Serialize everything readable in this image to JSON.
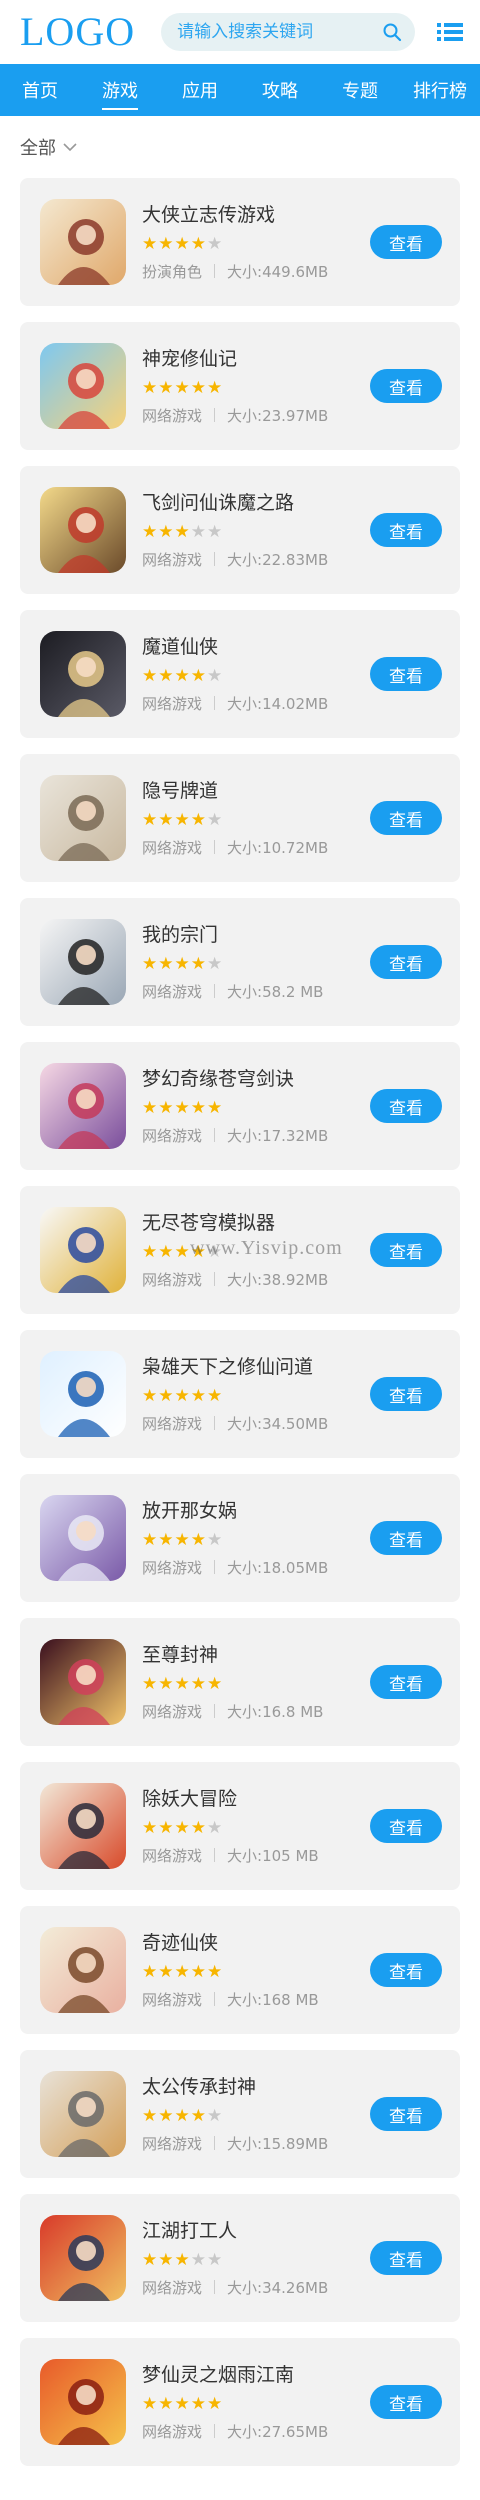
{
  "header": {
    "logo": "LOGO",
    "search_placeholder": "请输入搜索关键词",
    "search_icon": "search-icon",
    "menu_icon": "list-menu-icon"
  },
  "nav": {
    "active_index": 1,
    "items": [
      "首页",
      "游戏",
      "应用",
      "攻略",
      "专题",
      "排行榜"
    ]
  },
  "filter": {
    "label": "全部"
  },
  "button_label": "查看",
  "watermark": "www.Yisvip.com",
  "colors": {
    "accent": "#1a9ef0",
    "star": "#f7b500",
    "star_off": "#c8c8c8",
    "card_bg": "#f2f2f2"
  },
  "apps": [
    {
      "name": "大侠立志传游戏",
      "rating": 4,
      "category": "扮演角色",
      "size": "大小:449.6MB",
      "icon": "straw-hat-warrior-icon"
    },
    {
      "name": "神宠修仙记",
      "rating": 5,
      "category": "网络游戏",
      "size": "大小:23.97MB",
      "icon": "cute-pet-dragon-icon"
    },
    {
      "name": "飞剑问仙诛魔之路",
      "rating": 3,
      "category": "网络游戏",
      "size": "大小:22.83MB",
      "icon": "flying-sword-icon"
    },
    {
      "name": "魔道仙侠",
      "rating": 4,
      "category": "网络游戏",
      "size": "大小:14.02MB",
      "icon": "dark-warrior-icon"
    },
    {
      "name": "隐号牌道",
      "rating": 4,
      "category": "网络游戏",
      "size": "大小:10.72MB",
      "icon": "old-sage-icon"
    },
    {
      "name": "我的宗门",
      "rating": 4,
      "category": "网络游戏",
      "size": "大小:58.2 MB",
      "icon": "ink-swordsman-icon"
    },
    {
      "name": "梦幻奇缘苍穹剑诀",
      "rating": 5,
      "category": "网络游戏",
      "size": "大小:17.32MB",
      "icon": "fairy-girl-icon"
    },
    {
      "name": "无尽苍穹模拟器",
      "rating": 4,
      "category": "网络游戏",
      "size": "大小:38.92MB",
      "icon": "calligraphy-logo-icon"
    },
    {
      "name": "枭雄天下之修仙问道",
      "rating": 5,
      "category": "网络游戏",
      "size": "大小:34.50MB",
      "icon": "xian-character-icon"
    },
    {
      "name": "放开那女娲",
      "rating": 4,
      "category": "网络游戏",
      "size": "大小:18.05MB",
      "icon": "white-hair-goddess-icon"
    },
    {
      "name": "至尊封神",
      "rating": 5,
      "category": "网络游戏",
      "size": "大小:16.8 MB",
      "icon": "red-dress-heroine-icon"
    },
    {
      "name": "除妖大冒险",
      "rating": 4,
      "category": "网络游戏",
      "size": "大小:105 MB",
      "icon": "demon-hunter-icon"
    },
    {
      "name": "奇迹仙侠",
      "rating": 5,
      "category": "网络游戏",
      "size": "大小:168 MB",
      "icon": "flower-maiden-icon"
    },
    {
      "name": "太公传承封神",
      "rating": 4,
      "category": "网络游戏",
      "size": "大小:15.89MB",
      "icon": "fox-girl-icon"
    },
    {
      "name": "江湖打工人",
      "rating": 3,
      "category": "网络游戏",
      "size": "大小:34.26MB",
      "icon": "wanderer-icon"
    },
    {
      "name": "梦仙灵之烟雨江南",
      "rating": 5,
      "category": "网络游戏",
      "size": "大小:27.65MB",
      "icon": "meng-xian-ling-logo-icon"
    }
  ]
}
